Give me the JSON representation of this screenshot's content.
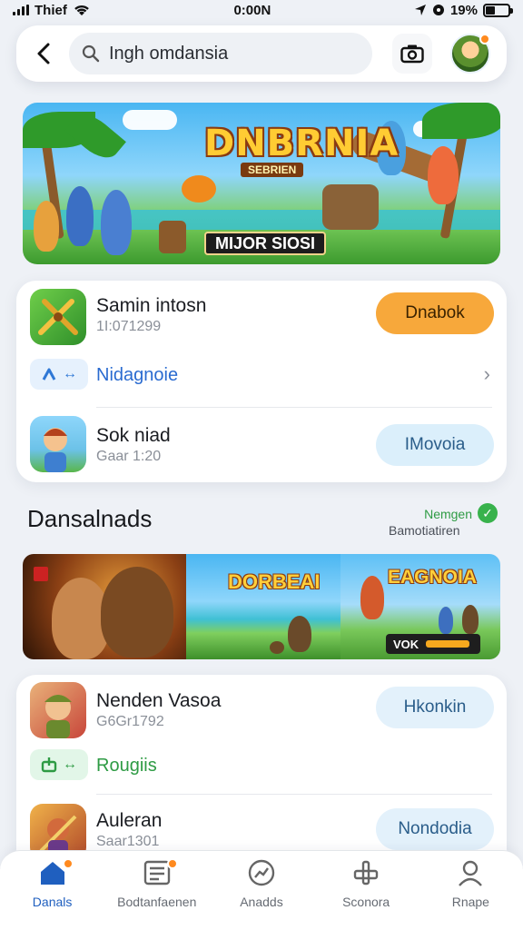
{
  "status_bar": {
    "carrier": "Thief",
    "time": "0:00N",
    "battery": "19%"
  },
  "header": {
    "search_value": "Ingh omdansia",
    "icons": [
      "back-icon",
      "search-icon",
      "camera-icon",
      "avatar"
    ]
  },
  "hero": {
    "title": "DNBRNIA",
    "subtitle": "SEBRIEN",
    "badge": "MIJOR SIOSI"
  },
  "card1": {
    "app1": {
      "name": "Samin intosn",
      "meta": "1I:071299",
      "button": "Dnabok"
    },
    "tag": {
      "label": "Nidagnoie"
    },
    "app2": {
      "name": "Sok niad",
      "meta": "Gaar 1:20",
      "button": "IMovoia"
    }
  },
  "section": {
    "title": "Dansalnads",
    "right_top": "Nemgen",
    "right_bottom": "Bamotiatiren"
  },
  "gallery": {
    "panel2_title": "DORBEAI",
    "panel3_title": "EAGNOIA",
    "panel3_badge": "VOK"
  },
  "card2": {
    "app1": {
      "name": "Nenden Vasoa",
      "meta": "G6Gr1792",
      "button": "Hkonkin"
    },
    "tag": {
      "label": "Rougiis"
    },
    "app2": {
      "name": "Auleran",
      "meta": "Saar1301",
      "button": "Nondodia"
    }
  },
  "bottom_nav": {
    "items": [
      {
        "label": "Danals",
        "icon": "home-icon"
      },
      {
        "label": "Bodtanfaenen",
        "icon": "news-icon"
      },
      {
        "label": "Anadds",
        "icon": "dashboard-icon"
      },
      {
        "label": "Sconora",
        "icon": "tools-icon"
      },
      {
        "label": "Rnape",
        "icon": "profile-icon"
      }
    ]
  },
  "colors": {
    "accent_orange": "#f7a83b",
    "accent_blue": "#1f5fbf",
    "pill_blue_bg": "#dbeffb",
    "green": "#38b24c"
  }
}
